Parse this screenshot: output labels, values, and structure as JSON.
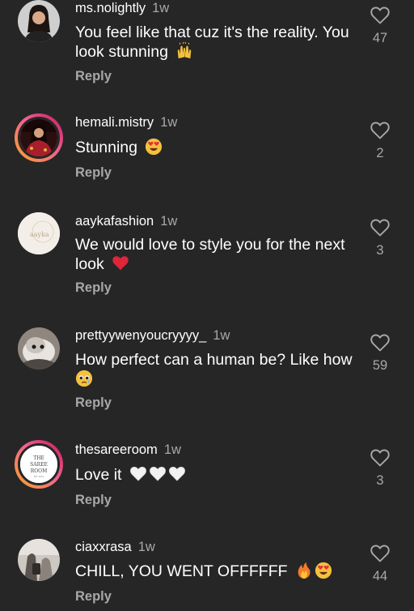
{
  "comments": [
    {
      "username": "ms.nolightly",
      "time": "1w",
      "text": "You feel like that cuz it's the reality. You look stunning",
      "emojis": [
        "raising-hands"
      ],
      "reply": "Reply",
      "likes": "47",
      "avatar": {
        "type": "photo",
        "ring": false,
        "colors": [
          "#d8d8d8",
          "#4a3a3a"
        ]
      }
    },
    {
      "username": "hemali.mistry",
      "time": "1w",
      "text": "Stunning",
      "emojis": [
        "heart-eyes"
      ],
      "reply": "Reply",
      "likes": "2",
      "avatar": {
        "type": "photo",
        "ring": true,
        "colors": [
          "#3a1414",
          "#b03030"
        ]
      }
    },
    {
      "username": "aaykafashion",
      "time": "1w",
      "text": "We would love to style you for the next look",
      "emojis": [
        "red-heart"
      ],
      "reply": "Reply",
      "likes": "3",
      "avatar": {
        "type": "logo",
        "ring": false,
        "logo_text": "aayka",
        "colors": [
          "#f3efe8",
          "#b8a88c"
        ]
      }
    },
    {
      "username": "prettyywenyoucryyyy_",
      "time": "1w",
      "text": "How perfect can a human be? Like how",
      "emojis": [
        "pleading-tear"
      ],
      "reply": "Reply",
      "likes": "59",
      "avatar": {
        "type": "photo",
        "ring": false,
        "colors": [
          "#b7b0aa",
          "#4e4842"
        ]
      }
    },
    {
      "username": "thesareeroom",
      "time": "1w",
      "text": "Love it",
      "emojis": [
        "white-heart",
        "white-heart",
        "white-heart"
      ],
      "reply": "Reply",
      "likes": "3",
      "avatar": {
        "type": "logo",
        "ring": true,
        "logo_text": "THE SAREE ROOM",
        "colors": [
          "#ffffff",
          "#555555"
        ]
      }
    },
    {
      "username": "ciaxxrasa",
      "time": "1w",
      "text": "CHILL, YOU WENT OFFFFFF",
      "emojis": [
        "fire",
        "heart-eyes"
      ],
      "reply": "Reply",
      "likes": "44",
      "avatar": {
        "type": "photo",
        "ring": false,
        "colors": [
          "#d7d2cc",
          "#555555"
        ]
      }
    }
  ],
  "colors": {
    "background": "#262626",
    "primary_text": "#ffffff",
    "secondary_text": "#a8a8a8",
    "story_ring": "#f06292"
  },
  "icons": {
    "like": "heart-outline-icon"
  }
}
